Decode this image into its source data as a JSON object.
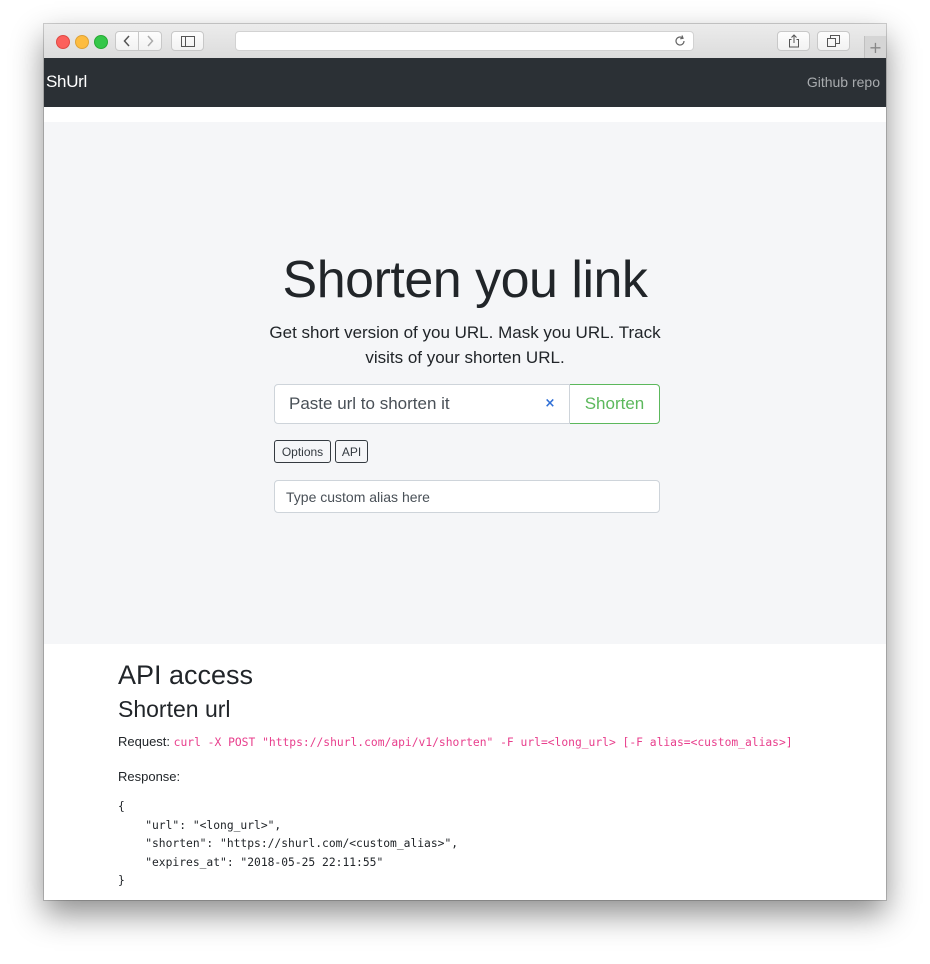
{
  "navbar": {
    "brand": "ShUrl",
    "github_link": "Github repo"
  },
  "hero": {
    "title": "Shorten you link",
    "lead": "Get short version of you URL. Mask you URL. Track visits of your shorten URL.",
    "url_input_placeholder": "Paste url to shorten it",
    "clear_symbol": "×",
    "shorten_button": "Shorten",
    "options_button": "Options",
    "api_button": "API",
    "alias_placeholder": "Type custom alias here"
  },
  "api": {
    "heading": "API access",
    "subheading": "Shorten url",
    "request_label": "Request:",
    "request_code": "curl -X POST \"https://shurl.com/api/v1/shorten\" -F url=<long_url> [-F alias=<custom_alias>]",
    "response_label": "Response:",
    "response_body": "{\n    \"url\": \"<long_url>\",\n    \"shorten\": \"https://shurl.com/<custom_alias>\",\n    \"expires_at\": \"2018-05-25 22:11:55\"\n}"
  },
  "colors": {
    "navbar_bg": "#2b3035",
    "jumbotron_bg": "#f5f6f8",
    "success_green": "#5cb85c",
    "code_pink": "#e83e8c"
  },
  "icons": [
    "back-icon",
    "forward-icon",
    "sidebar-icon",
    "reload-icon",
    "share-icon",
    "tabs-icon",
    "new-tab-icon",
    "clear-icon"
  ]
}
